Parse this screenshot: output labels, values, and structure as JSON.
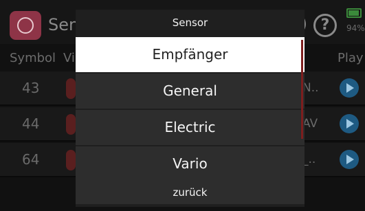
{
  "background": {
    "title": "Sen",
    "battery_pct": "94%",
    "help_glyph": "?",
    "paren": ")",
    "columns": {
      "symbol": "Symbol",
      "viz": "Vi",
      "play": "Play"
    },
    "rows": [
      {
        "number": "43",
        "trail": "N.."
      },
      {
        "number": "44",
        "trail": "AV"
      },
      {
        "number": "64",
        "trail": "_.."
      }
    ],
    "battery_level": 0.94,
    "colors": {
      "accent": "#8e3447",
      "play": "#1e5a82",
      "battery": "#3b8a3b"
    }
  },
  "modal": {
    "title": "Sensor",
    "options": [
      "Empfänger",
      "General",
      "Electric",
      "Vario"
    ],
    "selected_index": 0,
    "back_label": "zurück",
    "colors": {
      "selected_bg": "#ffffff",
      "option_bg": "#2d2d2d",
      "scrollbar": "#7d1e1e"
    }
  }
}
